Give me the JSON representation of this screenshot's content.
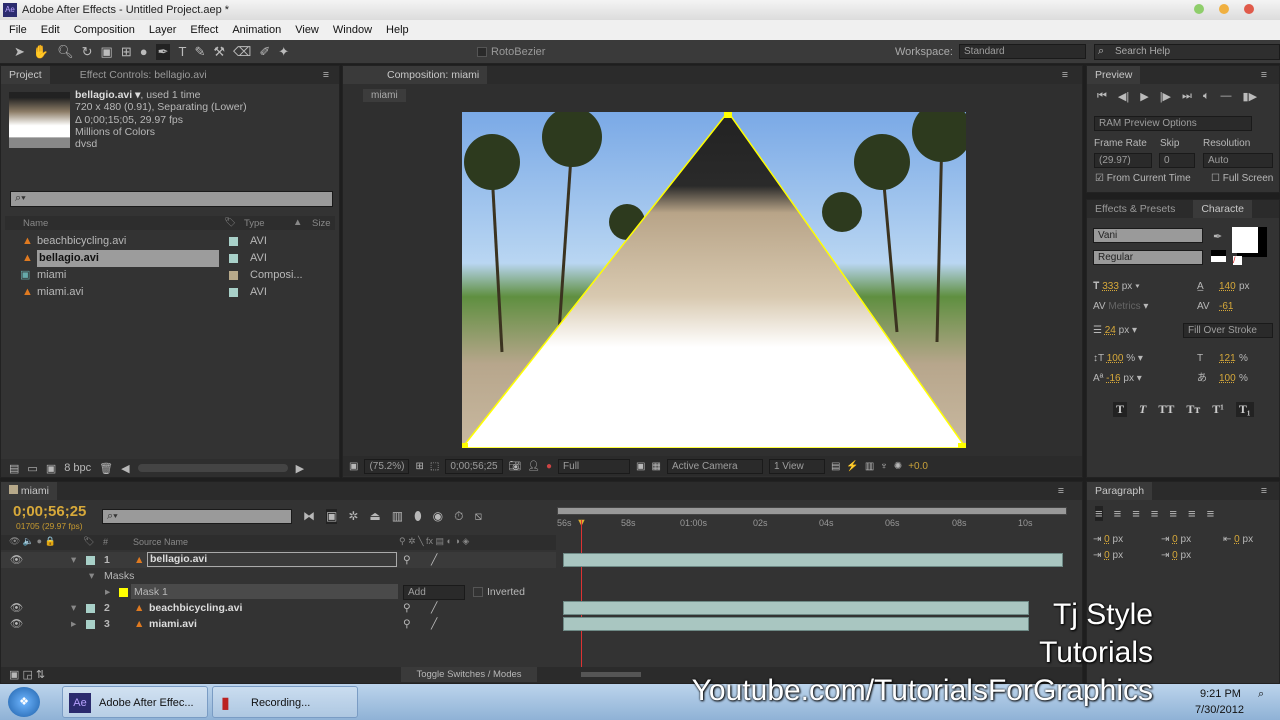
{
  "window": {
    "title": "Adobe After Effects - Untitled Project.aep *",
    "app_icon": "Ae"
  },
  "menu": [
    "File",
    "Edit",
    "Composition",
    "Layer",
    "Effect",
    "Animation",
    "View",
    "Window",
    "Help"
  ],
  "toolbar": {
    "rotobezier": "RotoBezier",
    "workspace_label": "Workspace:",
    "workspace_value": "Standard",
    "search_help": "Search Help"
  },
  "project": {
    "tab": "Project",
    "effect_controls_tab": "Effect Controls: bellagio.avi",
    "info": {
      "name": "bellagio.avi ▾",
      "used": ", used 1 time",
      "line2": "720 x 480 (0.91), Separating (Lower)",
      "line3": "Δ 0;00;15;05, 29.97 fps",
      "line4": "Millions of Colors",
      "line5": "dvsd"
    },
    "columns": {
      "name": "Name",
      "type": "Type",
      "size": "Size"
    },
    "items": [
      {
        "name": "beachbicycling.avi",
        "type": "AVI",
        "icon": "footage-icon"
      },
      {
        "name": "bellagio.avi",
        "type": "AVI",
        "icon": "footage-icon",
        "selected": true
      },
      {
        "name": "miami",
        "type": "Composi...",
        "icon": "composition-icon"
      },
      {
        "name": "miami.avi",
        "type": "AVI",
        "icon": "footage-icon"
      }
    ],
    "bpc": "8 bpc"
  },
  "composition": {
    "tab": "Composition: miami",
    "breadcrumb": "miami",
    "zoom": "(75.2%)",
    "timecode": "0;00;56;25",
    "resolution": "Full",
    "camera": "Active Camera",
    "views": "1 View",
    "exposure": "+0.0"
  },
  "preview": {
    "tab": "Preview",
    "ram_options": "RAM Preview Options",
    "frame_rate_label": "Frame Rate",
    "frame_rate": "(29.97)",
    "skip_label": "Skip",
    "skip": "0",
    "resolution_label": "Resolution",
    "resolution": "Auto",
    "from_current": "From Current Time",
    "full_screen": "Full Screen"
  },
  "character": {
    "effects_tab": "Effects & Presets",
    "tab": "Characte",
    "font": "Vani",
    "style": "Regular",
    "size": "333",
    "size_unit": "px",
    "leading": "140",
    "leading_unit": "px",
    "kerning": "Metrics",
    "tracking": "-61",
    "stroke": "24",
    "stroke_unit": "px",
    "stroke_mode": "Fill Over Stroke",
    "vscale": "100",
    "vscale_unit": "%",
    "hscale": "121",
    "hscale_unit": "%",
    "baseline": "-16",
    "baseline_unit": "px",
    "tsume": "100",
    "tsume_unit": "%",
    "styles": [
      "T",
      "T",
      "TT",
      "Tт",
      "T¹",
      "T₁"
    ]
  },
  "paragraph": {
    "tab": "Paragraph",
    "indents": [
      {
        "v": "0",
        "u": "px"
      },
      {
        "v": "0",
        "u": "px"
      },
      {
        "v": "0",
        "u": "px"
      },
      {
        "v": "0",
        "u": "px"
      },
      {
        "v": "0",
        "u": "px"
      }
    ]
  },
  "timeline": {
    "tab": "miami",
    "timecode": "0;00;56;25",
    "frames": "01705 (29.97 fps)",
    "source_name": "Source Name",
    "hash": "#",
    "ruler": [
      "56s",
      "58s",
      "01:00s",
      "02s",
      "04s",
      "06s",
      "08s",
      "10s"
    ],
    "layers": [
      {
        "num": "1",
        "name": "bellagio.avi"
      },
      {
        "num": "2",
        "name": "beachbicycling.avi"
      },
      {
        "num": "3",
        "name": "miami.avi"
      }
    ],
    "masks_label": "Masks",
    "mask_name": "Mask 1",
    "mask_mode": "Add",
    "inverted": "Inverted",
    "toggle": "Toggle Switches / Modes"
  },
  "watermark": {
    "line1": "Tj Style",
    "line2": "Tutorials",
    "line3": "Youtube.com/TutorialsForGraphics"
  },
  "taskbar": {
    "items": [
      "Adobe After Effec...",
      "Recording..."
    ],
    "time": "9:21 PM",
    "date": "7/30/2012"
  },
  "colors": {
    "accent": "#d7a93a",
    "mask": "#ffff00",
    "bar": "#a9c6c1"
  }
}
